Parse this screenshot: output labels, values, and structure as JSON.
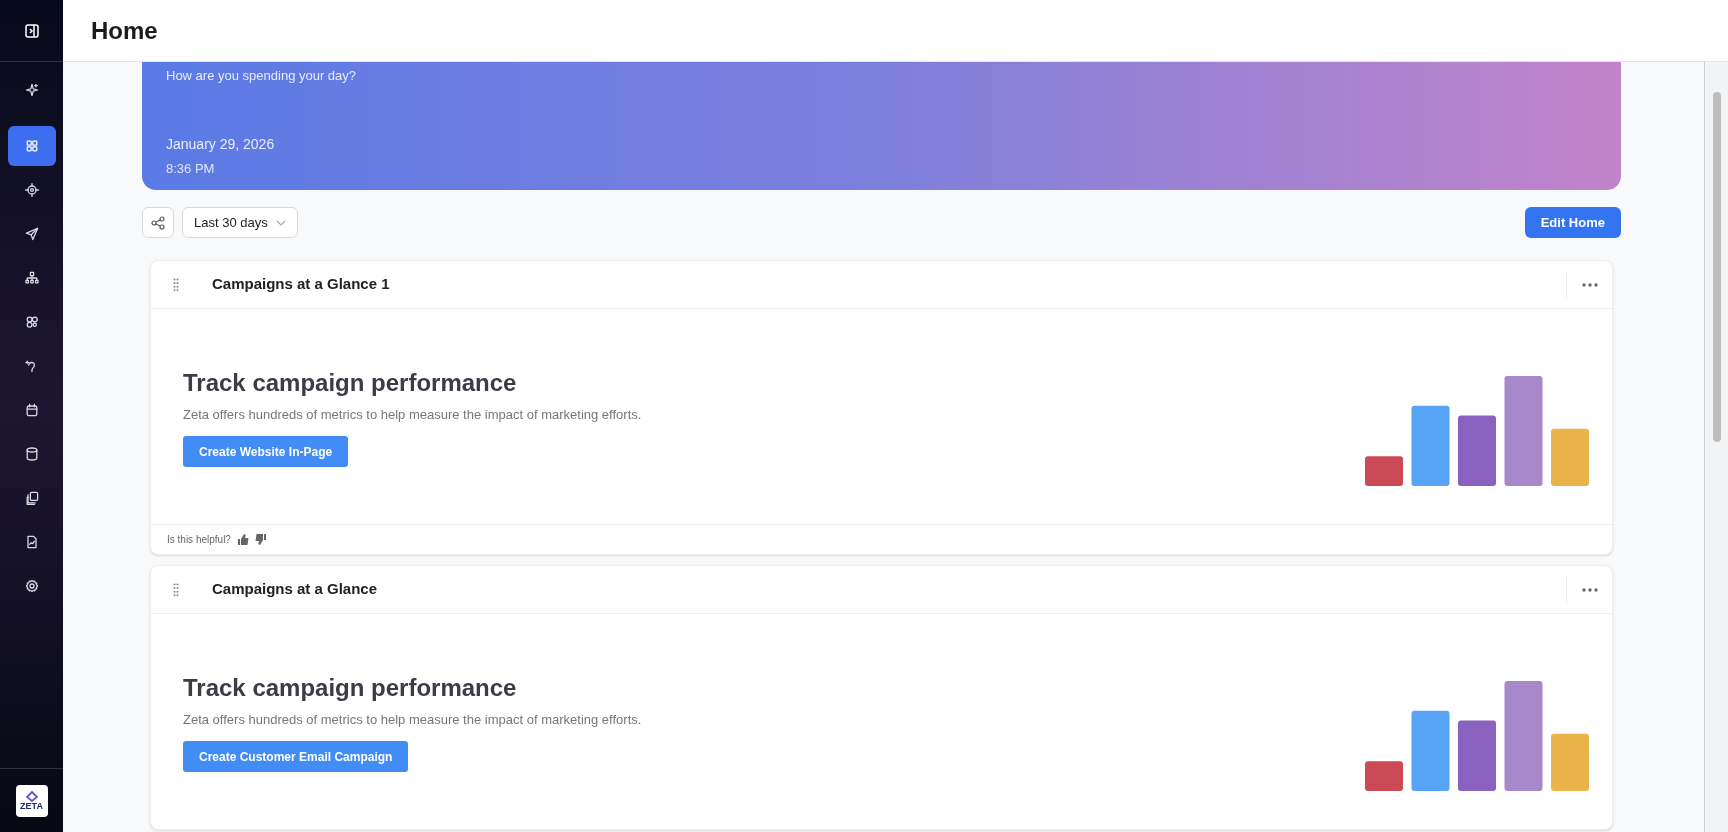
{
  "page_title": "Home",
  "sidebar": {
    "items": [
      {
        "selected": false
      },
      {
        "selected": true
      },
      {
        "selected": false
      },
      {
        "selected": false
      },
      {
        "selected": false
      },
      {
        "selected": false
      },
      {
        "selected": false
      },
      {
        "selected": false
      },
      {
        "selected": false
      },
      {
        "selected": false
      },
      {
        "selected": false
      },
      {
        "selected": false
      }
    ],
    "logo": "ZETA"
  },
  "banner": {
    "greeting": "How are you spending your day?",
    "date": "January 29, 2026",
    "time": "8:36 PM"
  },
  "toolbar": {
    "date_range": "Last 30 days",
    "edit_button": "Edit Home"
  },
  "cards": [
    {
      "title": "Campaigns at a Glance 1",
      "heading": "Track campaign performance",
      "description": "Zeta offers hundreds of metrics to help measure the impact of marketing efforts.",
      "button": "Create Website In-Page",
      "feedback": "Is this helpful?"
    },
    {
      "title": "Campaigns at a Glance",
      "heading": "Track campaign performance",
      "description": "Zeta offers hundreds of metrics to help measure the impact of marketing efforts.",
      "button": "Create Customer Email Campaign"
    }
  ]
}
